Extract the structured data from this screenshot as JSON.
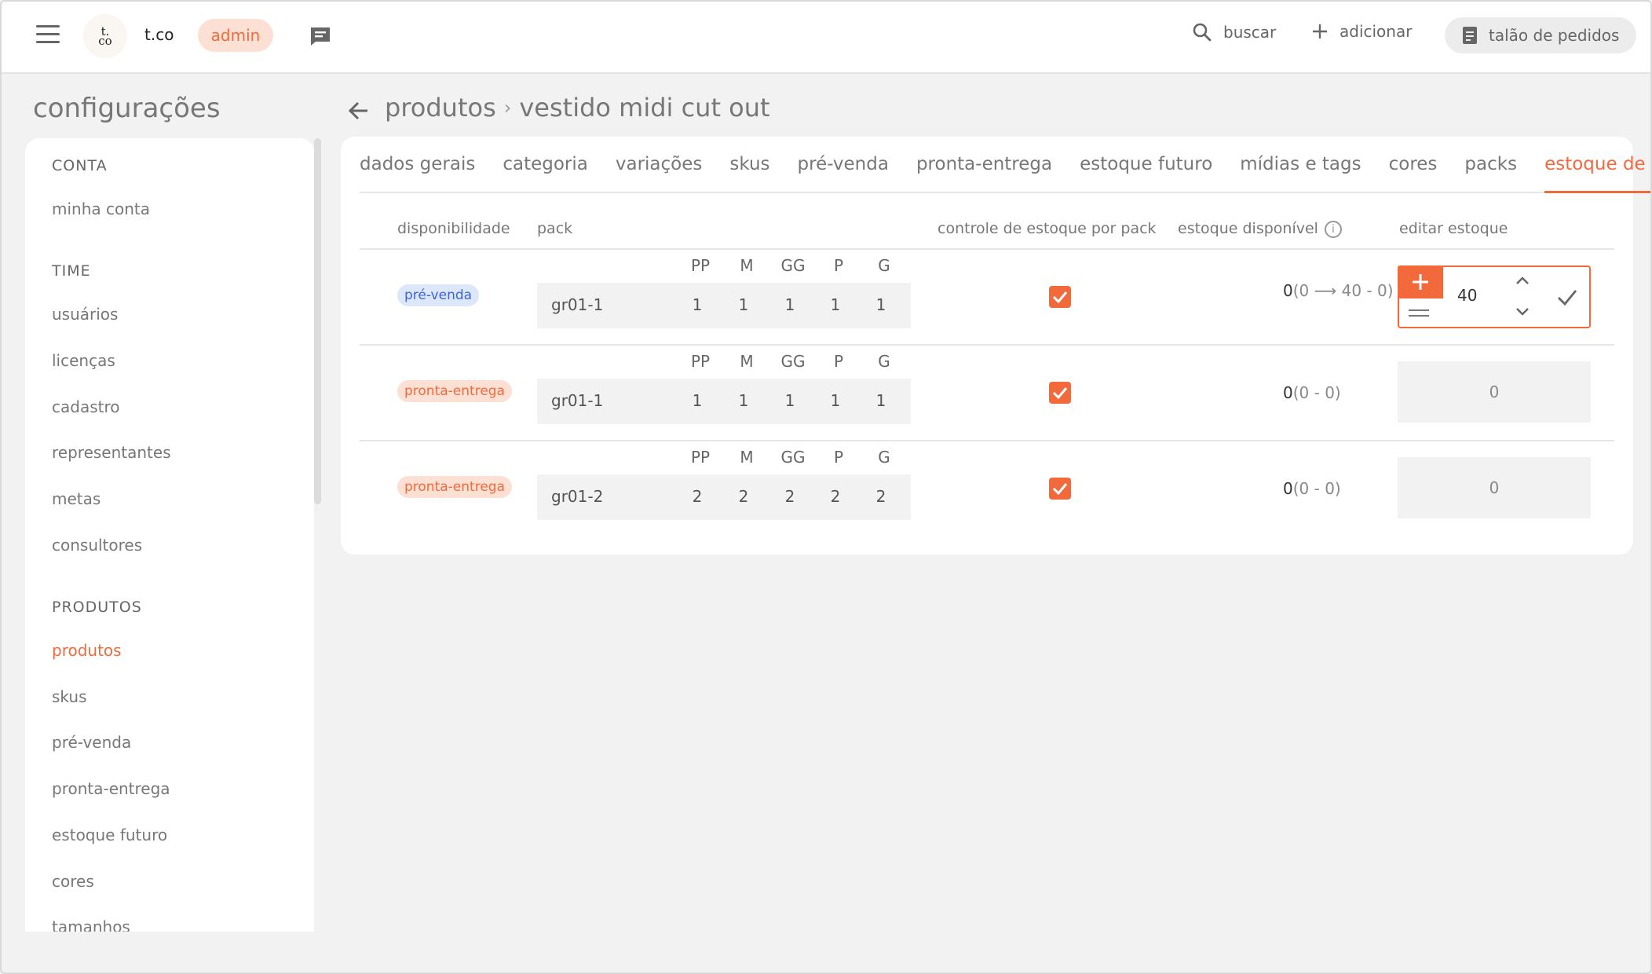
{
  "topbar": {
    "logo_text": "t.\nco",
    "brand": "t.co",
    "role_badge": "admin",
    "search_label": "buscar",
    "add_label": "adicionar",
    "orders_label": "talão de pedidos"
  },
  "page": {
    "title": "configurações"
  },
  "sidebar": {
    "sections": [
      {
        "title": "CONTA",
        "items": [
          "minha conta"
        ]
      },
      {
        "title": "TIME",
        "items": [
          "usuários",
          "licenças",
          "cadastro",
          "representantes",
          "metas",
          "consultores"
        ]
      },
      {
        "title": "PRODUTOS",
        "items": [
          "produtos",
          "skus",
          "pré-venda",
          "pronta-entrega",
          "estoque futuro",
          "cores",
          "tamanhos"
        ]
      }
    ],
    "active_item": "produtos"
  },
  "breadcrumb": {
    "parent": "produtos",
    "separator": "›",
    "current": "vestido midi cut out"
  },
  "tabs": [
    "dados gerais",
    "categoria",
    "variações",
    "skus",
    "pré-venda",
    "pronta-entrega",
    "estoque futuro",
    "mídias e tags",
    "cores",
    "packs",
    "estoque de packs"
  ],
  "active_tab": "estoque de packs",
  "table": {
    "headers": {
      "availability": "disponibilidade",
      "pack": "pack",
      "stock_control": "controle de estoque por pack",
      "available_stock": "estoque disponível",
      "edit_stock": "editar estoque"
    },
    "sizes": [
      "PP",
      "M",
      "GG",
      "P",
      "G"
    ],
    "rows": [
      {
        "availability": "pré-venda",
        "pack_name": "gr01-1",
        "quantities": [
          "1",
          "1",
          "1",
          "1",
          "1"
        ],
        "stock_control": true,
        "stock_main": "0",
        "stock_open": "(0 ",
        "stock_arrow": "⟶",
        "stock_rest": " 40 - 0)",
        "edit_value": "40",
        "editing": true
      },
      {
        "availability": "pronta-entrega",
        "pack_name": "gr01-1",
        "quantities": [
          "1",
          "1",
          "1",
          "1",
          "1"
        ],
        "stock_control": true,
        "stock_main": "0",
        "stock_detail": "(0 - 0)",
        "edit_value": "0",
        "editing": false
      },
      {
        "availability": "pronta-entrega",
        "pack_name": "gr01-2",
        "quantities": [
          "2",
          "2",
          "2",
          "2",
          "2"
        ],
        "stock_control": true,
        "stock_main": "0",
        "stock_detail": "(0 - 0)",
        "edit_value": "0",
        "editing": false
      }
    ]
  },
  "colors": {
    "accent": "#f26a3c",
    "pill_blue_bg": "#dde7fb",
    "pill_blue_text": "#3e64d8",
    "pill_orange_bg": "#fde0d4"
  },
  "icons": [
    "menu-icon",
    "chat-icon",
    "search-icon",
    "plus-icon",
    "notepad-icon",
    "back-arrow-icon",
    "info-icon",
    "check-icon",
    "chevron-up-icon",
    "chevron-down-icon",
    "equals-icon",
    "confirm-check-icon"
  ]
}
